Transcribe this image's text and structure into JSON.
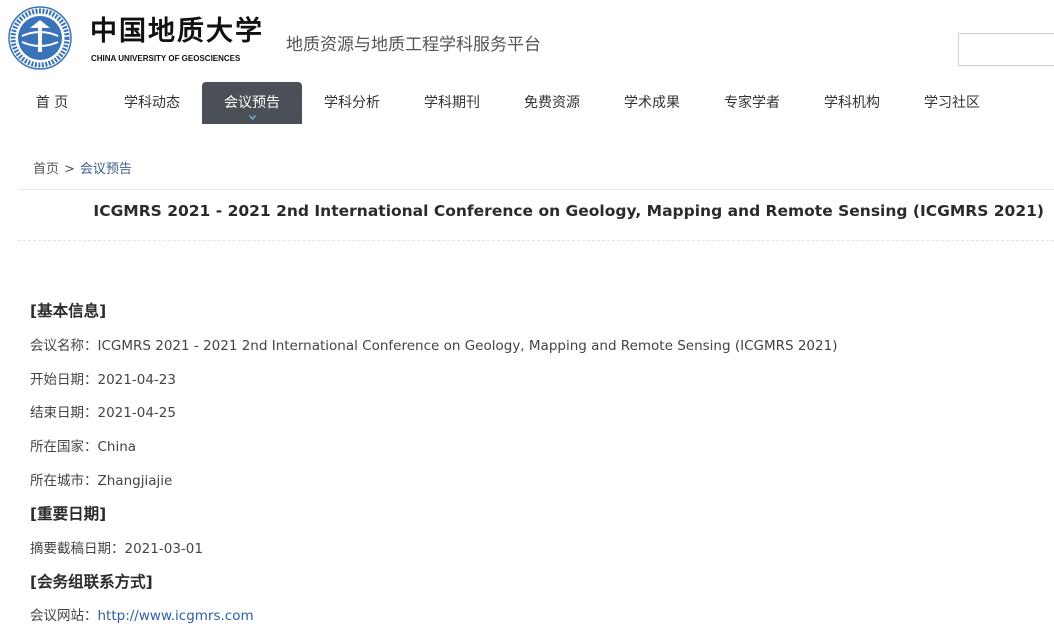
{
  "header": {
    "logo_cn": "中国地质大学",
    "logo_en": "CHINA UNIVERSITY OF GEOSCIENCES",
    "platform_title": "地质资源与地质工程学科服务平台",
    "search_value": ""
  },
  "nav": {
    "items": [
      {
        "label": "首 页"
      },
      {
        "label": "学科动态"
      },
      {
        "label": "会议预告"
      },
      {
        "label": "学科分析"
      },
      {
        "label": "学科期刊"
      },
      {
        "label": "免费资源"
      },
      {
        "label": "学术成果"
      },
      {
        "label": "专家学者"
      },
      {
        "label": "学科机构"
      },
      {
        "label": "学习社区"
      }
    ],
    "active": "会议预告"
  },
  "breadcrumb": {
    "home": "首页",
    "separator": ">",
    "current": "会议预告"
  },
  "page_title": "ICGMRS 2021 - 2021 2nd International Conference on Geology, Mapping and Remote Sensing (ICGMRS 2021)",
  "sections": {
    "basic": {
      "heading": "[基本信息]",
      "name_label": "会议名称：",
      "name_value": "ICGMRS 2021 - 2021 2nd International Conference on Geology, Mapping and Remote Sensing (ICGMRS 2021)",
      "start_label": "开始日期：",
      "start_value": "2021-04-23",
      "end_label": "结束日期：",
      "end_value": "2021-04-25",
      "country_label": "所在国家：",
      "country_value": "China",
      "city_label": "所在城市：",
      "city_value": "Zhangjiajie"
    },
    "dates": {
      "heading": "[重要日期]",
      "abstract_label": "摘要截稿日期：",
      "abstract_value": "2021-03-01"
    },
    "contact": {
      "heading": "[会务组联系方式]",
      "website_label": "会议网站：",
      "website_value": "http://www.icgmrs.com"
    }
  },
  "colors": {
    "nav_active_bg": "#4b4f57",
    "link": "#2d5fa6",
    "seal_blue": "#3a73b8"
  }
}
